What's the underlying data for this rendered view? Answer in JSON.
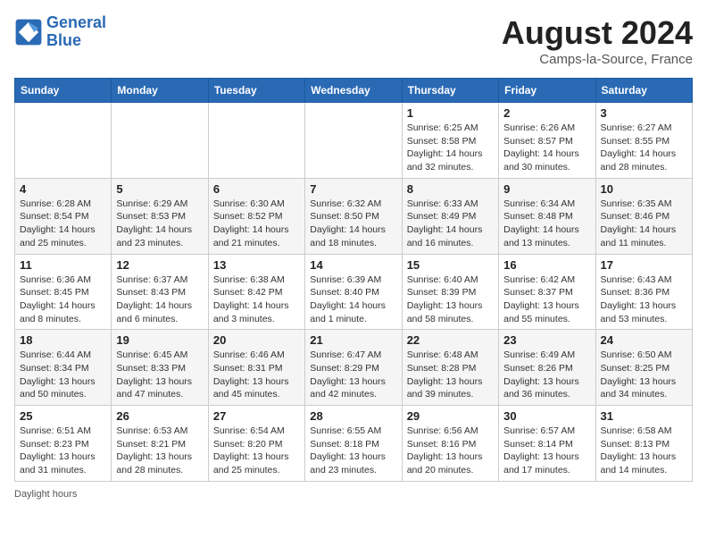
{
  "header": {
    "logo_line1": "General",
    "logo_line2": "Blue",
    "month_year": "August 2024",
    "location": "Camps-la-Source, France"
  },
  "days_of_week": [
    "Sunday",
    "Monday",
    "Tuesday",
    "Wednesday",
    "Thursday",
    "Friday",
    "Saturday"
  ],
  "weeks": [
    [
      {
        "day": "",
        "info": ""
      },
      {
        "day": "",
        "info": ""
      },
      {
        "day": "",
        "info": ""
      },
      {
        "day": "",
        "info": ""
      },
      {
        "day": "1",
        "info": "Sunrise: 6:25 AM\nSunset: 8:58 PM\nDaylight: 14 hours\nand 32 minutes."
      },
      {
        "day": "2",
        "info": "Sunrise: 6:26 AM\nSunset: 8:57 PM\nDaylight: 14 hours\nand 30 minutes."
      },
      {
        "day": "3",
        "info": "Sunrise: 6:27 AM\nSunset: 8:55 PM\nDaylight: 14 hours\nand 28 minutes."
      }
    ],
    [
      {
        "day": "4",
        "info": "Sunrise: 6:28 AM\nSunset: 8:54 PM\nDaylight: 14 hours\nand 25 minutes."
      },
      {
        "day": "5",
        "info": "Sunrise: 6:29 AM\nSunset: 8:53 PM\nDaylight: 14 hours\nand 23 minutes."
      },
      {
        "day": "6",
        "info": "Sunrise: 6:30 AM\nSunset: 8:52 PM\nDaylight: 14 hours\nand 21 minutes."
      },
      {
        "day": "7",
        "info": "Sunrise: 6:32 AM\nSunset: 8:50 PM\nDaylight: 14 hours\nand 18 minutes."
      },
      {
        "day": "8",
        "info": "Sunrise: 6:33 AM\nSunset: 8:49 PM\nDaylight: 14 hours\nand 16 minutes."
      },
      {
        "day": "9",
        "info": "Sunrise: 6:34 AM\nSunset: 8:48 PM\nDaylight: 14 hours\nand 13 minutes."
      },
      {
        "day": "10",
        "info": "Sunrise: 6:35 AM\nSunset: 8:46 PM\nDaylight: 14 hours\nand 11 minutes."
      }
    ],
    [
      {
        "day": "11",
        "info": "Sunrise: 6:36 AM\nSunset: 8:45 PM\nDaylight: 14 hours\nand 8 minutes."
      },
      {
        "day": "12",
        "info": "Sunrise: 6:37 AM\nSunset: 8:43 PM\nDaylight: 14 hours\nand 6 minutes."
      },
      {
        "day": "13",
        "info": "Sunrise: 6:38 AM\nSunset: 8:42 PM\nDaylight: 14 hours\nand 3 minutes."
      },
      {
        "day": "14",
        "info": "Sunrise: 6:39 AM\nSunset: 8:40 PM\nDaylight: 14 hours\nand 1 minute."
      },
      {
        "day": "15",
        "info": "Sunrise: 6:40 AM\nSunset: 8:39 PM\nDaylight: 13 hours\nand 58 minutes."
      },
      {
        "day": "16",
        "info": "Sunrise: 6:42 AM\nSunset: 8:37 PM\nDaylight: 13 hours\nand 55 minutes."
      },
      {
        "day": "17",
        "info": "Sunrise: 6:43 AM\nSunset: 8:36 PM\nDaylight: 13 hours\nand 53 minutes."
      }
    ],
    [
      {
        "day": "18",
        "info": "Sunrise: 6:44 AM\nSunset: 8:34 PM\nDaylight: 13 hours\nand 50 minutes."
      },
      {
        "day": "19",
        "info": "Sunrise: 6:45 AM\nSunset: 8:33 PM\nDaylight: 13 hours\nand 47 minutes."
      },
      {
        "day": "20",
        "info": "Sunrise: 6:46 AM\nSunset: 8:31 PM\nDaylight: 13 hours\nand 45 minutes."
      },
      {
        "day": "21",
        "info": "Sunrise: 6:47 AM\nSunset: 8:29 PM\nDaylight: 13 hours\nand 42 minutes."
      },
      {
        "day": "22",
        "info": "Sunrise: 6:48 AM\nSunset: 8:28 PM\nDaylight: 13 hours\nand 39 minutes."
      },
      {
        "day": "23",
        "info": "Sunrise: 6:49 AM\nSunset: 8:26 PM\nDaylight: 13 hours\nand 36 minutes."
      },
      {
        "day": "24",
        "info": "Sunrise: 6:50 AM\nSunset: 8:25 PM\nDaylight: 13 hours\nand 34 minutes."
      }
    ],
    [
      {
        "day": "25",
        "info": "Sunrise: 6:51 AM\nSunset: 8:23 PM\nDaylight: 13 hours\nand 31 minutes."
      },
      {
        "day": "26",
        "info": "Sunrise: 6:53 AM\nSunset: 8:21 PM\nDaylight: 13 hours\nand 28 minutes."
      },
      {
        "day": "27",
        "info": "Sunrise: 6:54 AM\nSunset: 8:20 PM\nDaylight: 13 hours\nand 25 minutes."
      },
      {
        "day": "28",
        "info": "Sunrise: 6:55 AM\nSunset: 8:18 PM\nDaylight: 13 hours\nand 23 minutes."
      },
      {
        "day": "29",
        "info": "Sunrise: 6:56 AM\nSunset: 8:16 PM\nDaylight: 13 hours\nand 20 minutes."
      },
      {
        "day": "30",
        "info": "Sunrise: 6:57 AM\nSunset: 8:14 PM\nDaylight: 13 hours\nand 17 minutes."
      },
      {
        "day": "31",
        "info": "Sunrise: 6:58 AM\nSunset: 8:13 PM\nDaylight: 13 hours\nand 14 minutes."
      }
    ]
  ],
  "footer": {
    "daylight_label": "Daylight hours"
  }
}
